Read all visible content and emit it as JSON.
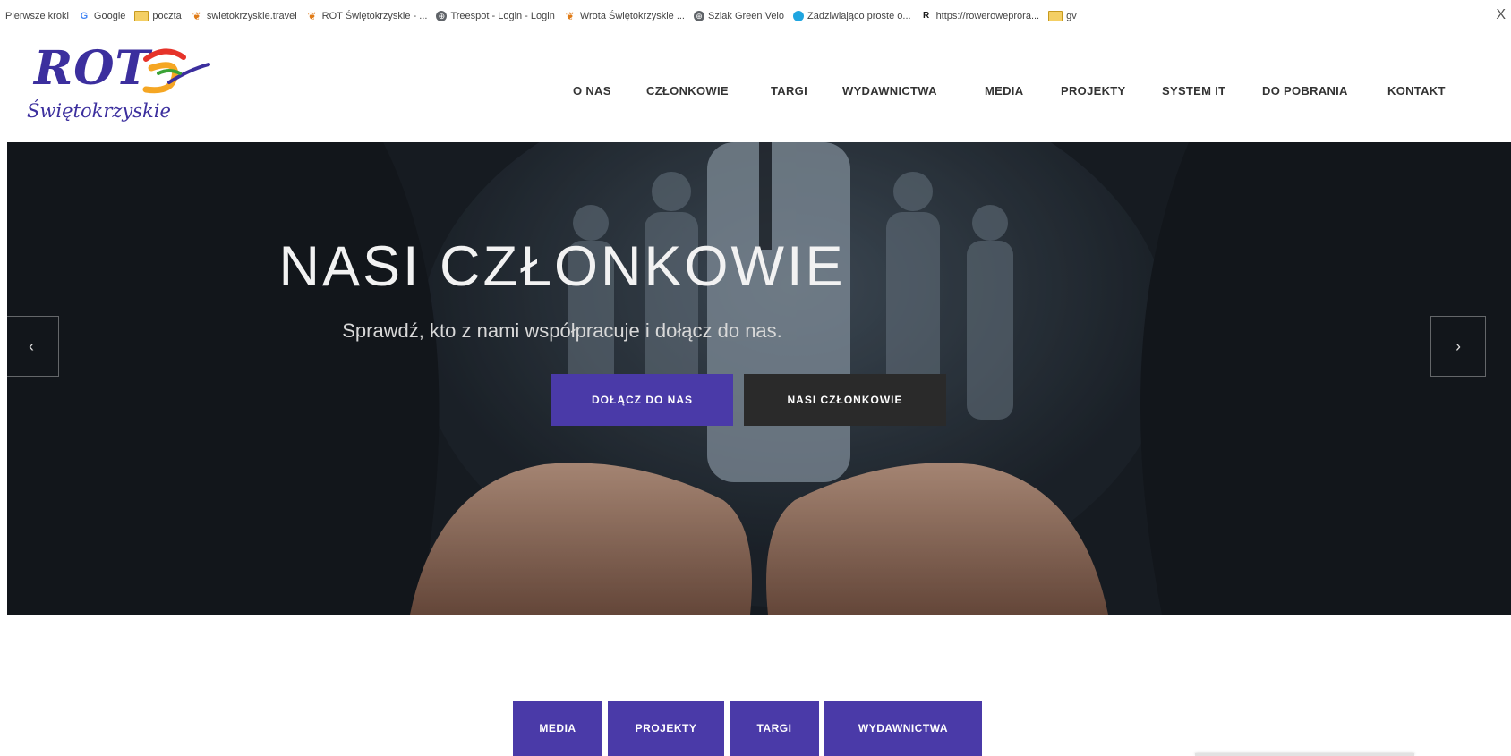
{
  "bookmarks": [
    {
      "label": "Pierwsze kroki",
      "icon": "none"
    },
    {
      "label": "Google",
      "icon": "google-icon"
    },
    {
      "label": "poczta",
      "icon": "folder-icon"
    },
    {
      "label": "swietokrzyskie.travel",
      "icon": "rot-icon"
    },
    {
      "label": "ROT Świętokrzyskie - ...",
      "icon": "rot-icon"
    },
    {
      "label": "Treespot - Login - Login",
      "icon": "globe-icon"
    },
    {
      "label": "Wrota Świętokrzyskie ...",
      "icon": "rot-icon"
    },
    {
      "label": "Szlak Green Velo",
      "icon": "globe-icon"
    },
    {
      "label": "Zadziwiająco proste o...",
      "icon": "cyan-circle-icon"
    },
    {
      "label": "https://roweroweprora...",
      "icon": "r-icon"
    },
    {
      "label": "gv",
      "icon": "folder-icon"
    }
  ],
  "bookmarks_close": "X",
  "logo": {
    "title": "ROT",
    "subtitle": "Świętokrzyskie"
  },
  "nav": [
    "O NAS",
    "CZŁONKOWIE",
    "TARGI",
    "WYDAWNICTWA",
    "MEDIA",
    "PROJEKTY",
    "SYSTEM IT",
    "DO POBRANIA",
    "KONTAKT"
  ],
  "hero": {
    "title": "NASI CZŁONKOWIE",
    "subtitle": "Sprawdź, kto z nami współpracuje i dołącz do nas.",
    "btn_primary": "DOŁĄCZ DO NAS",
    "btn_secondary": "NASI CZŁONKOWIE",
    "arrow_left": "‹",
    "arrow_right": "›"
  },
  "tabs": [
    "MEDIA",
    "PROJEKTY",
    "TARGI",
    "WYDAWNICTWA"
  ],
  "colors": {
    "accent": "#4a3aa8",
    "dark_button": "#2a2a2a",
    "logo": "#3c2f9e"
  }
}
